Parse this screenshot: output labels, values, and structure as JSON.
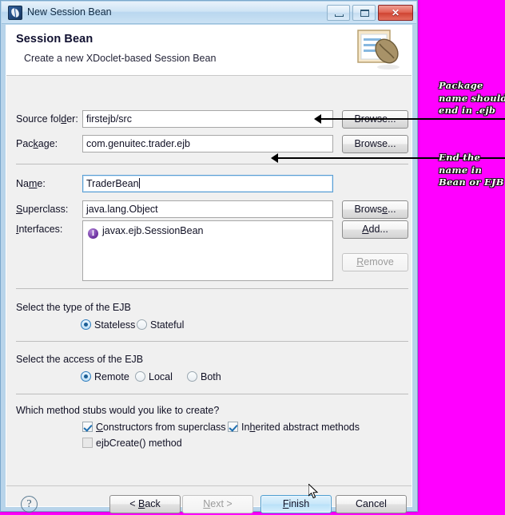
{
  "window": {
    "title": "New Session Bean",
    "icon": "session-bean-icon",
    "controls": {
      "minimize": "Minimize",
      "restore": "Restore",
      "close": "Close"
    }
  },
  "banner": {
    "title": "Session Bean",
    "subtitle": "Create a new XDoclet-based Session Bean",
    "icon": "bean-document-icon"
  },
  "form": {
    "source_folder": {
      "label_pre": "Source fol",
      "label_mnemonic": "d",
      "label_post": "er:",
      "value": "firstejb/src",
      "browse": "Browse..."
    },
    "package": {
      "label_pre": "Pac",
      "label_mnemonic": "k",
      "label_post": "age:",
      "value": "com.genuitec.trader.ejb",
      "browse": "Browse..."
    },
    "name": {
      "label_pre": "Na",
      "label_mnemonic": "m",
      "label_post": "e:",
      "value": "TraderBean"
    },
    "superclass": {
      "label_pre": "",
      "label_mnemonic": "S",
      "label_post": "uperclass:",
      "value": "java.lang.Object",
      "browse": "Brows",
      "browse_mnemonic": "e",
      "browse_post": "..."
    },
    "interfaces": {
      "label_pre": "",
      "label_mnemonic": "I",
      "label_post": "nterfaces:",
      "items": [
        {
          "icon": "interface-icon",
          "text": "javax.ejb.SessionBean"
        }
      ],
      "add_pre": "",
      "add_mnemonic": "A",
      "add_post": "dd...",
      "remove_pre": "",
      "remove_mnemonic": "R",
      "remove_post": "emove"
    }
  },
  "type_group": {
    "heading": "Select the type of the EJB",
    "options": [
      {
        "label": "Stateless",
        "selected": true
      },
      {
        "label": "Stateful",
        "selected": false
      }
    ]
  },
  "access_group": {
    "heading": "Select the access of the EJB",
    "options": [
      {
        "label": "Remote",
        "selected": true
      },
      {
        "label": "Local",
        "selected": false
      },
      {
        "label": "Both",
        "selected": false
      }
    ]
  },
  "stubs_group": {
    "heading": "Which method stubs would you like to create?",
    "options": [
      {
        "pre": "",
        "mnemonic": "C",
        "post": "onstructors from superclass",
        "checked": true,
        "enabled": true
      },
      {
        "pre": "In",
        "mnemonic": "h",
        "post": "erited abstract methods",
        "checked": true,
        "enabled": true
      },
      {
        "pre": "ejbCreate() method",
        "mnemonic": "",
        "post": "",
        "checked": false,
        "enabled": false
      }
    ]
  },
  "footer": {
    "help": "?",
    "buttons": [
      {
        "pre": "< ",
        "mnemonic": "B",
        "post": "ack",
        "state": "normal"
      },
      {
        "pre": "",
        "mnemonic": "N",
        "post": "ext >",
        "state": "disabled"
      },
      {
        "pre": "",
        "mnemonic": "F",
        "post": "inish",
        "state": "default"
      },
      {
        "pre": "Cancel",
        "mnemonic": "",
        "post": "",
        "state": "normal"
      }
    ]
  },
  "annotations": {
    "background_color": "#ff00ff",
    "notes": [
      {
        "lines": [
          "Package",
          "name should",
          "end in .ejb"
        ]
      },
      {
        "lines": [
          "End the",
          "name in",
          "Bean or EJB"
        ]
      }
    ]
  }
}
